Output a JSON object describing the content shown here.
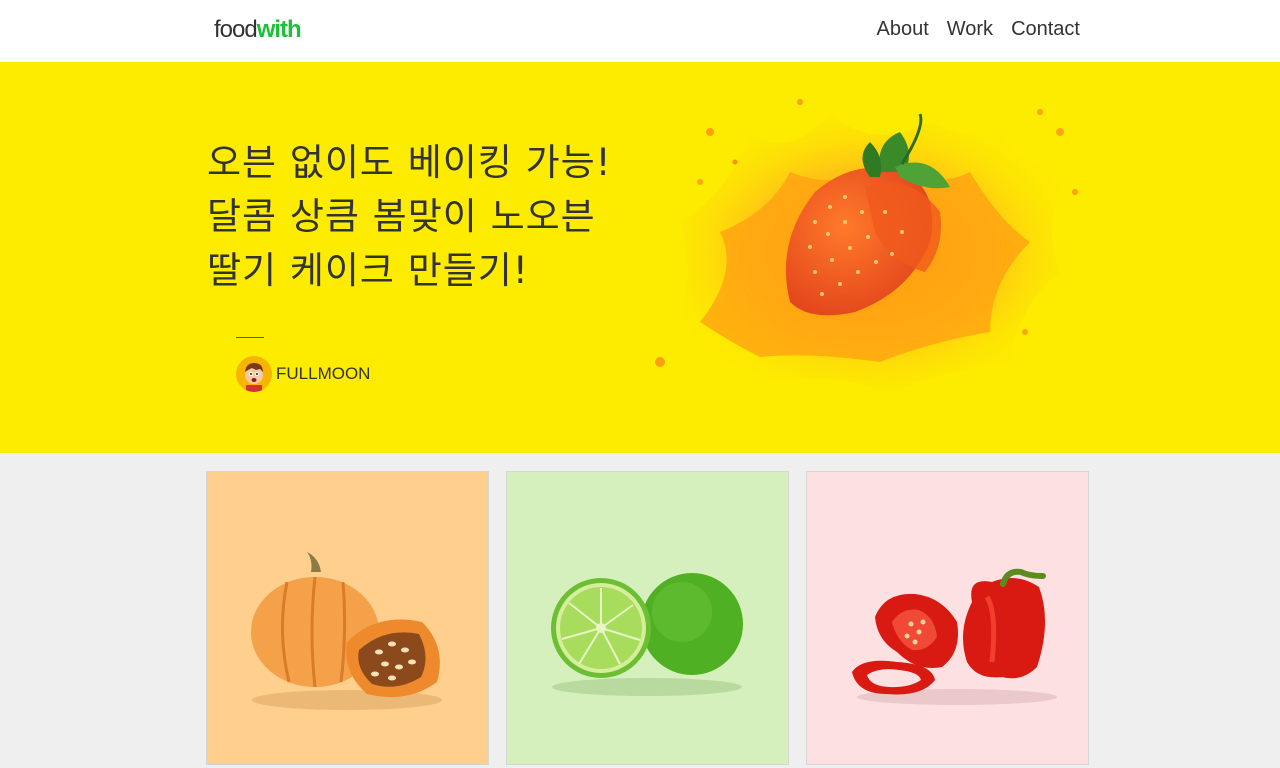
{
  "header": {
    "logo_food": "food",
    "logo_with": "with",
    "nav": [
      {
        "label": "About"
      },
      {
        "label": "Work"
      },
      {
        "label": "Contact"
      }
    ]
  },
  "hero": {
    "title_lines": [
      "오븐 없이도 베이킹 가능!",
      "달콤 상큼 봄맞이 노오븐",
      "딸기 케이크 만들기!"
    ],
    "author": "FULLMOON",
    "background_color": "#fdeb00",
    "image_icon": "strawberry-splash"
  },
  "cards": [
    {
      "image_icon": "pumpkin",
      "background_color": "#ffcf8e"
    },
    {
      "image_icon": "lime",
      "background_color": "#d5f0bd"
    },
    {
      "image_icon": "red-bell-pepper",
      "background_color": "#fde1e2"
    }
  ],
  "colors": {
    "brand_green": "#1fbf3a",
    "text": "#333333",
    "page_background": "#efefef"
  }
}
